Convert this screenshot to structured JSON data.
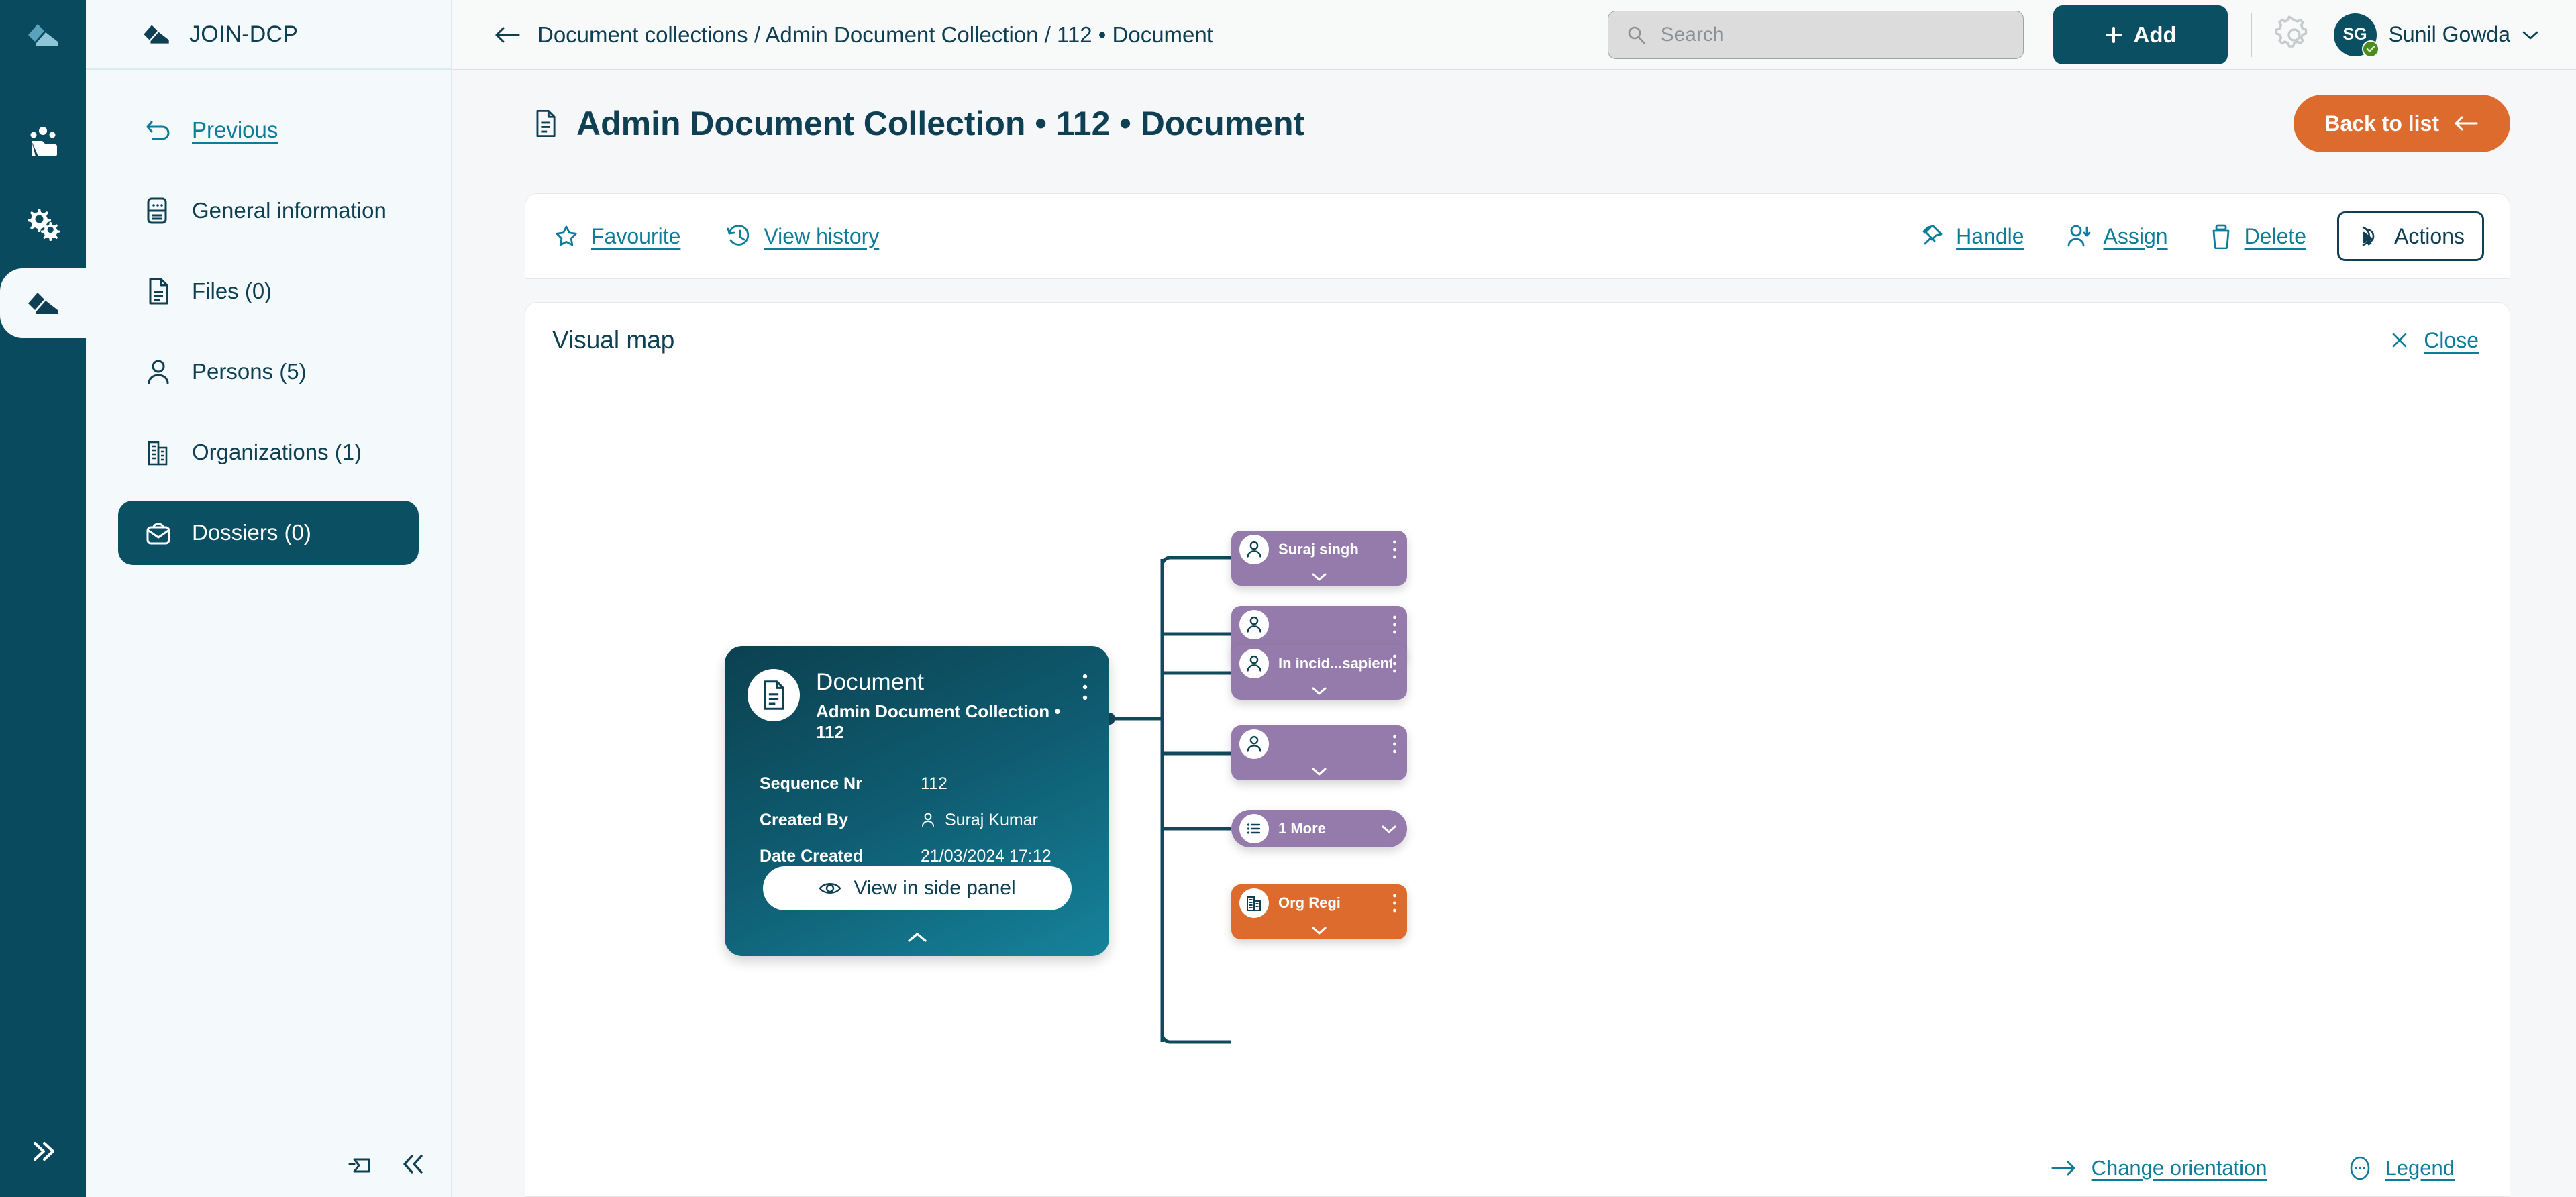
{
  "rail": {
    "logo_icon": "app-logo-icon",
    "items": [
      {
        "icon": "team-folder-icon",
        "name": "team-folder"
      },
      {
        "icon": "gears-icon",
        "name": "settings-gears"
      },
      {
        "icon": "app-logo-icon",
        "name": "dossier-module",
        "active": true
      }
    ],
    "expand_icon": "double-chevron-right-icon"
  },
  "sidebar": {
    "brand": "JOIN-DCP",
    "brand_icon": "app-logo-icon",
    "items": [
      {
        "label": "Previous",
        "icon": "undo-arrow-icon",
        "name": "sidebar-item-previous",
        "style": "link"
      },
      {
        "label": "General information",
        "icon": "info-document-icon",
        "name": "sidebar-item-general-information",
        "style": "normal"
      },
      {
        "label": "Files (0)",
        "icon": "file-icon",
        "name": "sidebar-item-files",
        "style": "normal"
      },
      {
        "label": "Persons (5)",
        "icon": "person-icon",
        "name": "sidebar-item-persons",
        "style": "normal"
      },
      {
        "label": "Organizations (1)",
        "icon": "building-icon",
        "name": "sidebar-item-organizations",
        "style": "normal"
      },
      {
        "label": "Dossiers (0)",
        "icon": "briefcase-icon",
        "name": "sidebar-item-dossiers",
        "style": "active"
      }
    ],
    "footer": {
      "pin_icon": "pin-icon",
      "collapse_icon": "double-chevron-left-icon"
    }
  },
  "topbar": {
    "back_icon": "arrow-left-icon",
    "breadcrumb": "Document collections / Admin Document Collection / 112 • Document",
    "search": {
      "placeholder": "Search",
      "value": "",
      "icon": "search-icon"
    },
    "add_label": "Add",
    "add_icon": "plus-icon",
    "settings_icon": "gear-icon",
    "user": {
      "initials": "SG",
      "name": "Sunil Gowda",
      "status_icon": "check-badge-icon",
      "caret_icon": "chevron-down-icon"
    }
  },
  "page": {
    "title": "Admin Document Collection • 112 • Document",
    "title_icon": "document-icon",
    "back_to_list_label": "Back to list",
    "back_to_list_icon": "arrow-left-icon"
  },
  "toolbar": {
    "left": [
      {
        "label": "Favourite",
        "icon": "star-icon",
        "name": "favourite-button"
      },
      {
        "label": "View history",
        "icon": "history-clock-icon",
        "name": "view-history-button"
      }
    ],
    "right": [
      {
        "label": "Handle",
        "icon": "pin-icon",
        "name": "handle-button"
      },
      {
        "label": "Assign",
        "icon": "person-assign-icon",
        "name": "assign-button"
      },
      {
        "label": "Delete",
        "icon": "trash-icon",
        "name": "delete-button"
      }
    ],
    "actions_label": "Actions",
    "actions_icon": "cursor-click-icon"
  },
  "map": {
    "title": "Visual map",
    "close_label": "Close",
    "close_icon": "close-x-icon",
    "footer": {
      "change_orientation_label": "Change orientation",
      "change_orientation_icon": "arrow-right-icon",
      "legend_label": "Legend",
      "legend_icon": "dots-circle-icon"
    },
    "root_node": {
      "type": "Document",
      "subtitle": "Admin Document Collection • 112",
      "icon": "document-icon",
      "kebab_icon": "kebab-menu-icon",
      "fields": [
        {
          "key": "Sequence Nr",
          "value": "112",
          "icon": ""
        },
        {
          "key": "Created By",
          "value": "Suraj Kumar",
          "icon": "person-icon"
        },
        {
          "key": "Date Created",
          "value": "21/03/2024 17:12",
          "icon": ""
        }
      ],
      "side_panel_label": "View in side panel",
      "side_panel_icon": "eye-icon",
      "collapse_icon": "chevron-up-icon"
    },
    "nodes": [
      {
        "label": "Suraj singh",
        "icon": "person-icon",
        "color": "purple",
        "shape": "card",
        "name": "map-node-suraj-singh"
      },
      {
        "label": "",
        "icon": "person-icon",
        "color": "purple",
        "shape": "card",
        "name": "map-node-person-2"
      },
      {
        "label": "In incid...sapiente",
        "icon": "person-icon",
        "color": "purple",
        "shape": "card",
        "name": "map-node-in-incid-sapiente"
      },
      {
        "label": "",
        "icon": "person-icon",
        "color": "purple",
        "shape": "card",
        "name": "map-node-person-4"
      },
      {
        "label": "1 More",
        "icon": "list-icon",
        "color": "purple",
        "shape": "pill",
        "name": "map-node-more"
      },
      {
        "label": "Org Regi",
        "icon": "building-icon",
        "color": "orange",
        "shape": "card",
        "name": "map-node-org-regi"
      }
    ]
  },
  "colors": {
    "navy": "#0b4f63",
    "teal": "#0d7c99",
    "orange": "#dd6b2d",
    "purple": "#957bab",
    "panel": "#f4f9fb"
  }
}
